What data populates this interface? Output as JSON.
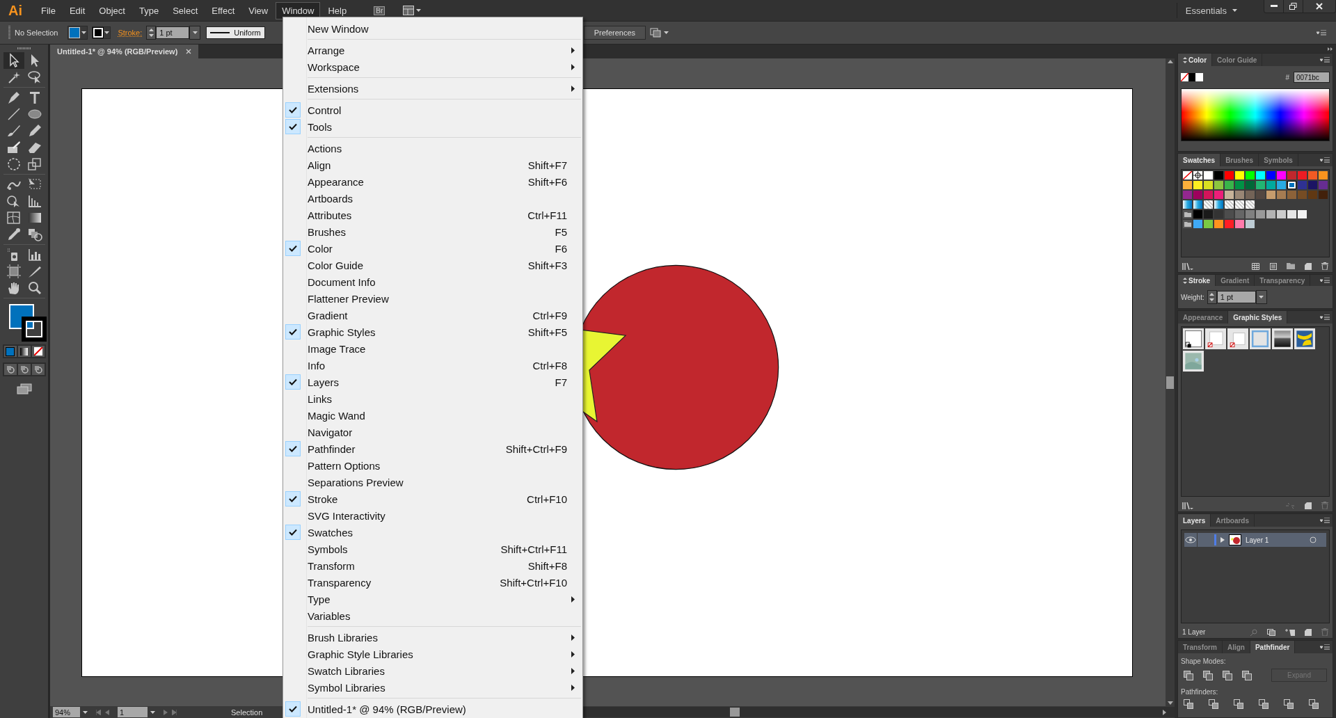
{
  "menubar": {
    "logo": "Ai",
    "menus": [
      {
        "label": "File",
        "selected": false
      },
      {
        "label": "Edit",
        "selected": false
      },
      {
        "label": "Object",
        "selected": false
      },
      {
        "label": "Type",
        "selected": false
      },
      {
        "label": "Select",
        "selected": false
      },
      {
        "label": "Effect",
        "selected": false
      },
      {
        "label": "View",
        "selected": false
      },
      {
        "label": "Window",
        "selected": true
      },
      {
        "label": "Help",
        "selected": false
      }
    ],
    "bridge": "Br",
    "workspace": "Essentials"
  },
  "control_bar": {
    "selection": "No Selection",
    "stroke_label": "Stroke:",
    "stroke_weight": "1 pt",
    "profile": "Uniform",
    "preferences": "Preferences"
  },
  "document_tab": {
    "title": "Untitled-1* @ 94% (RGB/Preview)"
  },
  "window_menu": {
    "groups": [
      {
        "items": [
          {
            "label": "New Window",
            "checked": false,
            "submenu": false
          }
        ]
      },
      {
        "items": [
          {
            "label": "Arrange",
            "checked": false,
            "submenu": true
          },
          {
            "label": "Workspace",
            "checked": false,
            "submenu": true
          }
        ]
      },
      {
        "items": [
          {
            "label": "Extensions",
            "checked": false,
            "submenu": true
          }
        ]
      },
      {
        "items": [
          {
            "label": "Control",
            "checked": true,
            "submenu": false
          },
          {
            "label": "Tools",
            "checked": true,
            "submenu": false
          }
        ]
      },
      {
        "items": [
          {
            "label": "Actions",
            "checked": false,
            "submenu": false
          },
          {
            "label": "Align",
            "shortcut": "Shift+F7",
            "checked": false,
            "submenu": false
          },
          {
            "label": "Appearance",
            "shortcut": "Shift+F6",
            "checked": false,
            "submenu": false
          },
          {
            "label": "Artboards",
            "checked": false,
            "submenu": false
          },
          {
            "label": "Attributes",
            "shortcut": "Ctrl+F11",
            "checked": false,
            "submenu": false
          },
          {
            "label": "Brushes",
            "shortcut": "F5",
            "checked": false,
            "submenu": false
          },
          {
            "label": "Color",
            "shortcut": "F6",
            "checked": true,
            "submenu": false
          },
          {
            "label": "Color Guide",
            "shortcut": "Shift+F3",
            "checked": false,
            "submenu": false
          },
          {
            "label": "Document Info",
            "checked": false,
            "submenu": false
          },
          {
            "label": "Flattener Preview",
            "checked": false,
            "submenu": false
          },
          {
            "label": "Gradient",
            "shortcut": "Ctrl+F9",
            "checked": false,
            "submenu": false
          },
          {
            "label": "Graphic Styles",
            "shortcut": "Shift+F5",
            "checked": true,
            "submenu": false
          },
          {
            "label": "Image Trace",
            "checked": false,
            "submenu": false
          },
          {
            "label": "Info",
            "shortcut": "Ctrl+F8",
            "checked": false,
            "submenu": false
          },
          {
            "label": "Layers",
            "shortcut": "F7",
            "checked": true,
            "submenu": false
          },
          {
            "label": "Links",
            "checked": false,
            "submenu": false
          },
          {
            "label": "Magic Wand",
            "checked": false,
            "submenu": false
          },
          {
            "label": "Navigator",
            "checked": false,
            "submenu": false
          },
          {
            "label": "Pathfinder",
            "shortcut": "Shift+Ctrl+F9",
            "checked": true,
            "submenu": false
          },
          {
            "label": "Pattern Options",
            "checked": false,
            "submenu": false
          },
          {
            "label": "Separations Preview",
            "checked": false,
            "submenu": false
          },
          {
            "label": "Stroke",
            "shortcut": "Ctrl+F10",
            "checked": true,
            "submenu": false
          },
          {
            "label": "SVG Interactivity",
            "checked": false,
            "submenu": false
          },
          {
            "label": "Swatches",
            "checked": true,
            "submenu": false
          },
          {
            "label": "Symbols",
            "shortcut": "Shift+Ctrl+F11",
            "checked": false,
            "submenu": false
          },
          {
            "label": "Transform",
            "shortcut": "Shift+F8",
            "checked": false,
            "submenu": false
          },
          {
            "label": "Transparency",
            "shortcut": "Shift+Ctrl+F10",
            "checked": false,
            "submenu": false
          },
          {
            "label": "Type",
            "checked": false,
            "submenu": true
          },
          {
            "label": "Variables",
            "checked": false,
            "submenu": false
          }
        ]
      },
      {
        "items": [
          {
            "label": "Brush Libraries",
            "checked": false,
            "submenu": true
          },
          {
            "label": "Graphic Style Libraries",
            "checked": false,
            "submenu": true
          },
          {
            "label": "Swatch Libraries",
            "checked": false,
            "submenu": true
          },
          {
            "label": "Symbol Libraries",
            "checked": false,
            "submenu": true
          }
        ]
      },
      {
        "items": [
          {
            "label": "Untitled-1* @ 94% (RGB/Preview)",
            "checked": true,
            "submenu": false
          }
        ]
      }
    ]
  },
  "status_bar": {
    "zoom": "94%",
    "artboard": "1",
    "tool": "Selection"
  },
  "panels": {
    "color": {
      "tabs": [
        {
          "label": "Color",
          "selected": true
        },
        {
          "label": "Color Guide",
          "selected": false
        }
      ],
      "hex_label": "#",
      "hex": "0071bc"
    },
    "swatches": {
      "tabs": [
        {
          "label": "Swatches",
          "selected": true
        },
        {
          "label": "Brushes",
          "selected": false
        },
        {
          "label": "Symbols",
          "selected": false
        }
      ],
      "rows": [
        {
          "folder": false,
          "items": [
            {
              "kind": "none"
            },
            {
              "kind": "registration"
            },
            {
              "kind": "color",
              "color": "#ffffff",
              "selected": false
            },
            {
              "kind": "color",
              "color": "#000000",
              "selected": false
            },
            {
              "kind": "color",
              "color": "#ff0000",
              "selected": false
            },
            {
              "kind": "color",
              "color": "#ffff00",
              "selected": false
            },
            {
              "kind": "color",
              "color": "#00ff00",
              "selected": false
            },
            {
              "kind": "color",
              "color": "#00ffff",
              "selected": false
            },
            {
              "kind": "color",
              "color": "#0000ff",
              "selected": false
            },
            {
              "kind": "color",
              "color": "#ff00ff",
              "selected": false
            },
            {
              "kind": "color",
              "color": "#c1272d",
              "selected": false
            },
            {
              "kind": "color",
              "color": "#ed1c24",
              "selected": false
            },
            {
              "kind": "color",
              "color": "#f15a24",
              "selected": false
            },
            {
              "kind": "color",
              "color": "#f7931e",
              "selected": false
            }
          ]
        },
        {
          "folder": false,
          "items": [
            {
              "kind": "color",
              "color": "#fbb03b",
              "selected": false
            },
            {
              "kind": "color",
              "color": "#fcee21",
              "selected": false
            },
            {
              "kind": "color",
              "color": "#d9e021",
              "selected": false
            },
            {
              "kind": "color",
              "color": "#8cc63f",
              "selected": false
            },
            {
              "kind": "color",
              "color": "#39b54a",
              "selected": false
            },
            {
              "kind": "color",
              "color": "#009245",
              "selected": false
            },
            {
              "kind": "color",
              "color": "#006837",
              "selected": false
            },
            {
              "kind": "color",
              "color": "#22b573",
              "selected": false
            },
            {
              "kind": "color",
              "color": "#00a99d",
              "selected": false
            },
            {
              "kind": "color",
              "color": "#29abe2",
              "selected": false
            },
            {
              "kind": "color",
              "color": "#0071bc",
              "selected": true
            },
            {
              "kind": "color",
              "color": "#2e3192",
              "selected": false
            },
            {
              "kind": "color",
              "color": "#1b1464",
              "selected": false
            },
            {
              "kind": "color",
              "color": "#662d91",
              "selected": false
            }
          ]
        },
        {
          "folder": false,
          "items": [
            {
              "kind": "color",
              "color": "#93278f",
              "selected": false
            },
            {
              "kind": "color",
              "color": "#9e005d",
              "selected": false
            },
            {
              "kind": "color",
              "color": "#d4145a",
              "selected": false
            },
            {
              "kind": "color",
              "color": "#ed1e79",
              "selected": false
            },
            {
              "kind": "color",
              "color": "#c7b299",
              "selected": false
            },
            {
              "kind": "color",
              "color": "#998675",
              "selected": false
            },
            {
              "kind": "color",
              "color": "#736357",
              "selected": false
            },
            {
              "kind": "color",
              "color": "#534741",
              "selected": false
            },
            {
              "kind": "color",
              "color": "#c69c6d",
              "selected": false
            },
            {
              "kind": "color",
              "color": "#a67c52",
              "selected": false
            },
            {
              "kind": "color",
              "color": "#8c6239",
              "selected": false
            },
            {
              "kind": "color",
              "color": "#754c24",
              "selected": false
            },
            {
              "kind": "color",
              "color": "#603813",
              "selected": false
            },
            {
              "kind": "color",
              "color": "#42210b",
              "selected": false
            }
          ]
        },
        {
          "folder": false,
          "items": [
            {
              "kind": "gradient"
            },
            {
              "kind": "gradient"
            },
            {
              "kind": "pattern"
            },
            {
              "kind": "gradient"
            },
            {
              "kind": "pattern"
            },
            {
              "kind": "pattern"
            },
            {
              "kind": "pattern"
            }
          ]
        },
        {
          "folder": true,
          "items": [
            {
              "kind": "color",
              "color": "#000000",
              "selected": false
            },
            {
              "kind": "color",
              "color": "#1a1a1a",
              "selected": false
            },
            {
              "kind": "color",
              "color": "#333333",
              "selected": false
            },
            {
              "kind": "color",
              "color": "#4d4d4d",
              "selected": false
            },
            {
              "kind": "color",
              "color": "#666666",
              "selected": false
            },
            {
              "kind": "color",
              "color": "#808080",
              "selected": false
            },
            {
              "kind": "color",
              "color": "#999999",
              "selected": false
            },
            {
              "kind": "color",
              "color": "#b3b3b3",
              "selected": false
            },
            {
              "kind": "color",
              "color": "#cccccc",
              "selected": false
            },
            {
              "kind": "color",
              "color": "#e6e6e6",
              "selected": false
            },
            {
              "kind": "color",
              "color": "#f2f2f2",
              "selected": false
            }
          ]
        },
        {
          "folder": true,
          "items": [
            {
              "kind": "color",
              "color": "#3fa9f5",
              "selected": false
            },
            {
              "kind": "color",
              "color": "#7ac943",
              "selected": false
            },
            {
              "kind": "color",
              "color": "#ff931e",
              "selected": false
            },
            {
              "kind": "color",
              "color": "#ff1d25",
              "selected": false
            },
            {
              "kind": "color",
              "color": "#ff7bac",
              "selected": false
            },
            {
              "kind": "color",
              "color": "#bdccd4",
              "selected": false
            }
          ]
        }
      ]
    },
    "stroke": {
      "tabs": [
        {
          "label": "Stroke",
          "selected": true
        },
        {
          "label": "Gradient",
          "selected": false
        },
        {
          "label": "Transparency",
          "selected": false
        }
      ],
      "weight_label": "Weight:",
      "weight": "1 pt"
    },
    "graphic_styles": {
      "tabs": [
        {
          "label": "Appearance",
          "selected": false
        },
        {
          "label": "Graphic Styles",
          "selected": true
        }
      ]
    },
    "layers": {
      "tabs": [
        {
          "label": "Layers",
          "selected": true
        },
        {
          "label": "Artboards",
          "selected": false
        }
      ],
      "layers": [
        {
          "name": "Layer 1",
          "visible": true,
          "selected": true
        }
      ],
      "footer": "1 Layer"
    },
    "pathfinder": {
      "tabs": [
        {
          "label": "Transform",
          "selected": false
        },
        {
          "label": "Align",
          "selected": false
        },
        {
          "label": "Pathfinder",
          "selected": true
        }
      ],
      "shape_modes_label": "Shape Modes:",
      "expand": {
        "label": "Expand",
        "disabled": true
      },
      "pathfinders_label": "Pathfinders:"
    }
  }
}
